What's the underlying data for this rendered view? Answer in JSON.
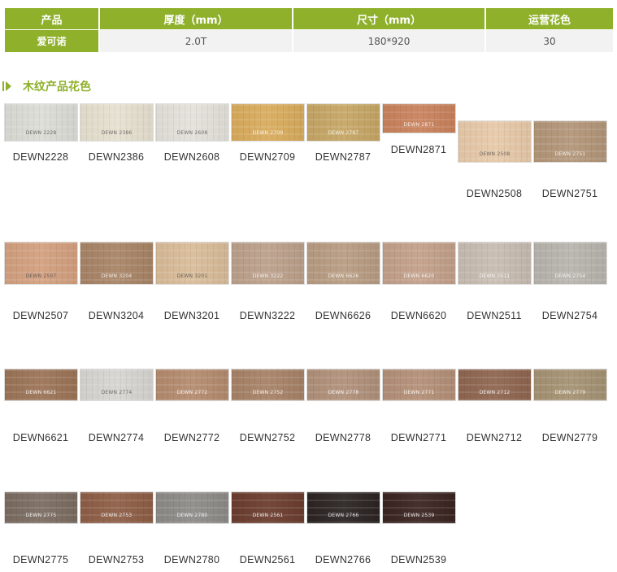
{
  "spec_table": {
    "headers": [
      "产品",
      "厚度（mm）",
      "尺寸（mm）",
      "运营花色"
    ],
    "row": [
      "爱可诺",
      "2.0T",
      "180*920",
      "30"
    ]
  },
  "section": {
    "title": "木纹产品花色"
  },
  "swatches": [
    {
      "code": "DEWN2228",
      "stamp": "DEWN 2228",
      "color": "#dcdcd6",
      "light": true
    },
    {
      "code": "DEWN2386",
      "stamp": "DEWN 2386",
      "color": "#e6e0cf",
      "light": true
    },
    {
      "code": "DEWN2608",
      "stamp": "DEWN 2608",
      "color": "#e3e1da",
      "light": true
    },
    {
      "code": "DEWN2709",
      "stamp": "DEWN 2709",
      "color": "#d9ac5d",
      "light": false
    },
    {
      "code": "DEWN2787",
      "stamp": "DEWN 2787",
      "color": "#c6a665",
      "light": false
    },
    {
      "code": "DEWN2871",
      "stamp": "DEWN 2871",
      "color": "#c9825c",
      "light": false
    },
    {
      "code": "DEWN2508",
      "stamp": "DEWN 2508",
      "color": "#e7c9a8",
      "light": true
    },
    {
      "code": "DEWN2751",
      "stamp": "DEWN 2751",
      "color": "#b39679",
      "light": false
    },
    {
      "code": "DEWN2507",
      "stamp": "DEWN 2507",
      "color": "#d3a07f",
      "light": true
    },
    {
      "code": "DEWN3204",
      "stamp": "DEWN 3204",
      "color": "#a88466",
      "light": false
    },
    {
      "code": "DEWN3201",
      "stamp": "DEWN 3201",
      "color": "#d9bc99",
      "light": true
    },
    {
      "code": "DEWN3222",
      "stamp": "DEWN 3222",
      "color": "#bca08a",
      "light": false
    },
    {
      "code": "DEWN6626",
      "stamp": "DEWN 6626",
      "color": "#b89c82",
      "light": false
    },
    {
      "code": "DEWN6620",
      "stamp": "DEWN 6620",
      "color": "#c3a08a",
      "light": false
    },
    {
      "code": "DEWN2511",
      "stamp": "DEWN 2511",
      "color": "#c7bcb1",
      "light": false
    },
    {
      "code": "DEWN2754",
      "stamp": "DEWN 2754",
      "color": "#b8b4ad",
      "light": false
    },
    {
      "code": "DEWN6621",
      "stamp": "DEWN 6621",
      "color": "#9c7457",
      "light": false
    },
    {
      "code": "DEWN2774",
      "stamp": "DEWN 2774",
      "color": "#d7d5d1",
      "light": true
    },
    {
      "code": "DEWN2772",
      "stamp": "DEWN 2772",
      "color": "#b48b6e",
      "light": false
    },
    {
      "code": "DEWN2752",
      "stamp": "DEWN 2752",
      "color": "#a78267",
      "light": false
    },
    {
      "code": "DEWN2778",
      "stamp": "DEWN 2778",
      "color": "#b0907a",
      "light": false
    },
    {
      "code": "DEWN2771",
      "stamp": "DEWN 2771",
      "color": "#b38f77",
      "light": false
    },
    {
      "code": "DEWN2712",
      "stamp": "DEWN 2712",
      "color": "#8f6650",
      "light": false
    },
    {
      "code": "DEWN2779",
      "stamp": "DEWN 2779",
      "color": "#a59273",
      "light": false
    },
    {
      "code": "DEWN2775",
      "stamp": "DEWN 2775",
      "color": "#7b6c61",
      "light": false
    },
    {
      "code": "DEWN2753",
      "stamp": "DEWN 2753",
      "color": "#8e5e46",
      "light": false
    },
    {
      "code": "DEWN2780",
      "stamp": "DEWN 2780",
      "color": "#8d8b87",
      "light": false
    },
    {
      "code": "DEWN2561",
      "stamp": "DEWN 2561",
      "color": "#6b3d2e",
      "light": false
    },
    {
      "code": "DEWN2766",
      "stamp": "DEWN 2766",
      "color": "#2b2422",
      "light": false
    },
    {
      "code": "DEWN2539",
      "stamp": "DEWN 2539",
      "color": "#3a2420",
      "light": false
    }
  ]
}
